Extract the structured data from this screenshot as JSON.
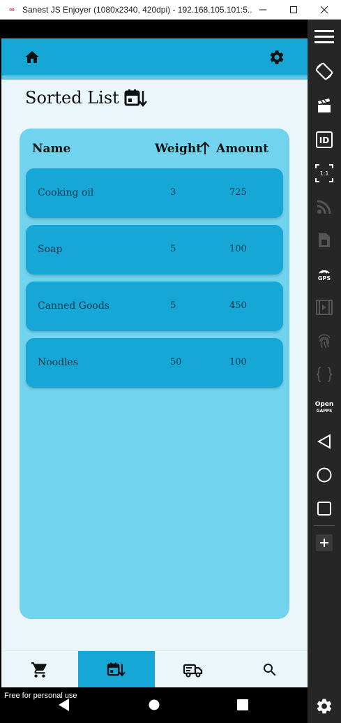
{
  "window": {
    "title": "Sanest JS Enjoyer (1080x2340, 420dpi) - 192.168.105.101:5...",
    "minimize": "minimize",
    "maximize": "maximize",
    "close": "close"
  },
  "appbar": {
    "home_icon": "home-icon",
    "settings_icon": "gear-icon",
    "color": "#17a7d6"
  },
  "page": {
    "title": "Sorted List"
  },
  "table": {
    "columns": {
      "name": "Name",
      "weight": "Weight",
      "amount": "Amount"
    },
    "sort": {
      "column": "Weight",
      "direction": "ascending"
    },
    "rows": [
      {
        "name": "Cooking oil",
        "weight": "3",
        "amount": "725"
      },
      {
        "name": "Soap",
        "weight": "5",
        "amount": "100"
      },
      {
        "name": "Canned Goods",
        "weight": "5",
        "amount": "450"
      },
      {
        "name": "Noodles",
        "weight": "50",
        "amount": "100"
      }
    ]
  },
  "bottom_nav": {
    "items": [
      {
        "icon": "cart-icon",
        "active": false
      },
      {
        "icon": "calendar-sort-icon",
        "active": true
      },
      {
        "icon": "truck-icon",
        "active": false
      },
      {
        "icon": "search-icon",
        "active": false
      }
    ]
  },
  "android_nav": {
    "back": "back-icon",
    "home": "home-circle-icon",
    "recents": "recents-icon"
  },
  "watermark": "Free for personal use",
  "toolbar": {
    "items": [
      "menu-icon",
      "rotate-icon",
      "clapperboard-icon",
      "id-icon",
      "scale-icon",
      "rss-icon",
      "sim-card-icon",
      "gps-icon",
      "video-icon",
      "fingerprint-icon",
      "braces-icon",
      "open-gapps-icon",
      "back-icon",
      "home-circle-icon",
      "recents-icon",
      "plus-icon",
      "gear-icon"
    ],
    "scale_label": "1:1",
    "gps_label": "GPS",
    "opengapps_label_1": "Open",
    "opengapps_label_2": "GAPPS",
    "id_label": "ID"
  }
}
